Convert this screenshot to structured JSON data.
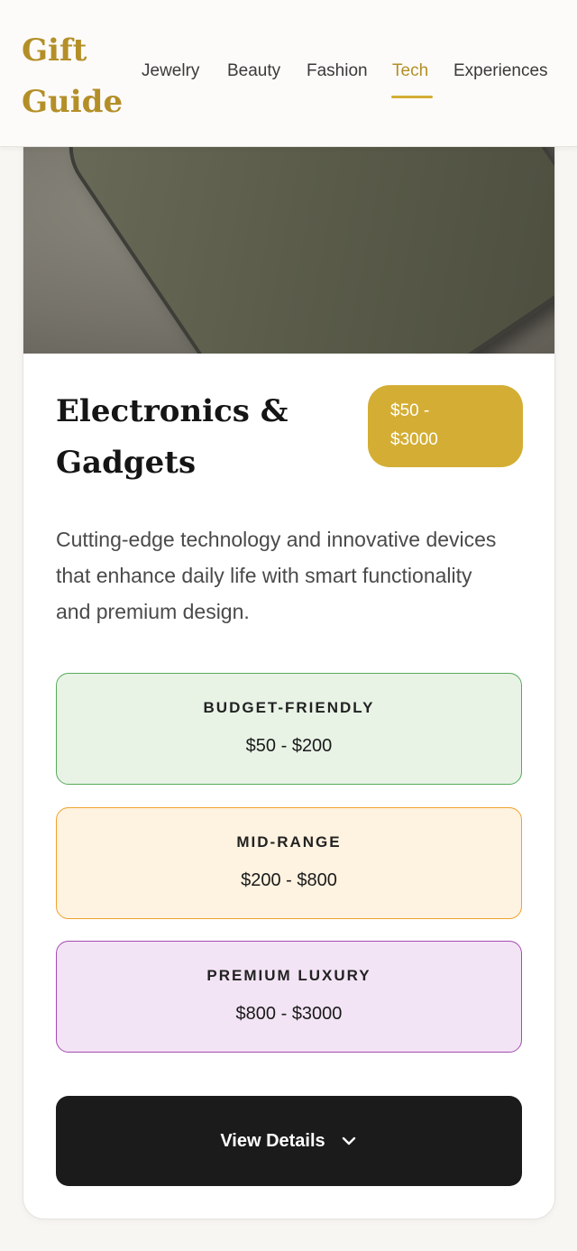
{
  "logo": {
    "line1": "Gift",
    "line2": "Guide"
  },
  "nav": {
    "items": [
      {
        "label": "Jewelry",
        "active": false
      },
      {
        "label": "Beauty",
        "active": false
      },
      {
        "label": "Fashion",
        "active": false
      },
      {
        "label": "Tech",
        "active": true
      },
      {
        "label": "Experiences",
        "active": false
      }
    ]
  },
  "card": {
    "title_line1": "Electronics &",
    "title_line2": "Gadgets",
    "price_line1": "$50 -",
    "price_line2": "$3000",
    "description": "Cutting-edge technology and innovative devices that enhance daily life with smart functionality and premium design.",
    "tiers": [
      {
        "name": "BUDGET-FRIENDLY",
        "range": "$50 - $200"
      },
      {
        "name": "MID-RANGE",
        "range": "$200 - $800"
      },
      {
        "name": "PREMIUM LUXURY",
        "range": "$800 - $3000"
      }
    ],
    "details_label": "View Details",
    "details_icon": "chevron-down-icon"
  },
  "colors": {
    "accent": "#b48f28",
    "badge": "#d4ae34",
    "budget_bg": "#e8f3e6",
    "budget_border": "#58a95a",
    "mid_bg": "#fef2e0",
    "mid_border": "#efa22e",
    "luxury_bg": "#f3e4f5",
    "luxury_border": "#a54bb2",
    "button": "#1b1b1b"
  }
}
